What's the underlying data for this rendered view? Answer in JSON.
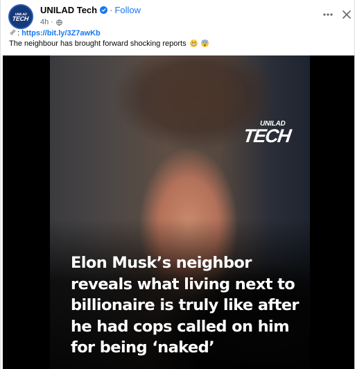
{
  "post": {
    "page_name": "UNILAD Tech",
    "separator": "·",
    "follow_label": "Follow",
    "timestamp": "4h ·",
    "link_prefix": ":",
    "short_link": "https://bit.ly/3Z7awKb",
    "caption": "The neighbour has brought forward shocking reports",
    "avatar_text_top": "UNILAD",
    "avatar_text_main": "TECH"
  },
  "icons": {
    "more": "more-options-icon",
    "close": "close-icon",
    "verified": "verified-badge-icon",
    "globe": "globe-icon",
    "link": "link-icon",
    "emoji_1": "grimacing-face-emoji",
    "emoji_2": "fearful-face-emoji"
  },
  "media": {
    "brand_top": "UNILAD",
    "brand_main": "TECH",
    "headline_lines": [
      "Elon Musk’s neighbor",
      "reveals what living next to",
      "billionaire is truly like after",
      "he had cops called on him",
      "for being ‘naked’"
    ]
  },
  "colors": {
    "accent": "#1877f2",
    "avatar_bg": "#15397a",
    "secondary_text": "#65676b"
  }
}
